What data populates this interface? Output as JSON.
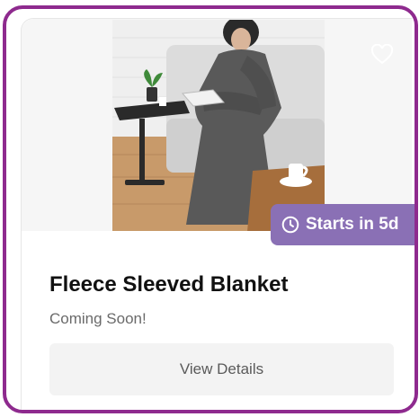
{
  "product": {
    "image_alt": "Person wearing gray fleece sleeved blanket reading on a couch",
    "badge_text": "Starts in 5d",
    "title": "Fleece Sleeved Blanket",
    "status": "Coming Soon!",
    "cta_label": "View Details"
  },
  "icons": {
    "favorite": "heart-outline-icon",
    "badge": "clock-icon"
  },
  "colors": {
    "frame_border": "#8e2a8e",
    "badge_bg": "#8a70b5",
    "button_bg": "#f3f3f3",
    "title": "#111111",
    "subtitle": "#6a6a6a"
  }
}
